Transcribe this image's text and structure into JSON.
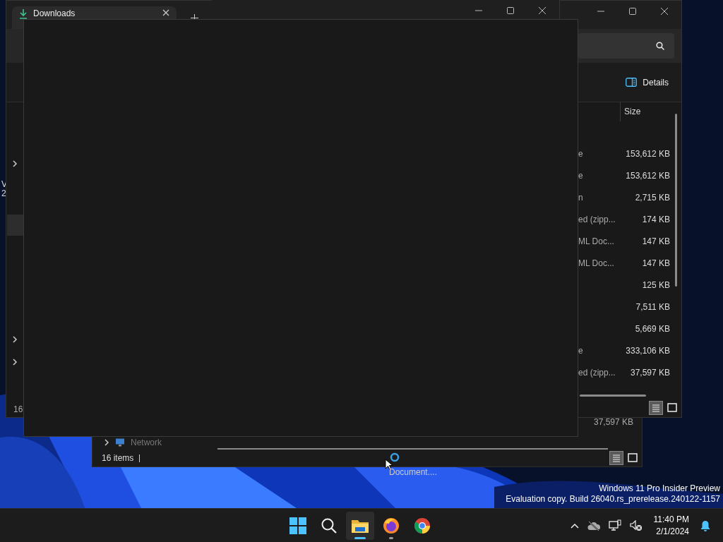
{
  "desktop": {
    "labels": [
      "V",
      "2"
    ],
    "watermark": [
      "Windows 11 Pro Insider Preview",
      "Evaluation copy. Build 26040.rs_prerelease.240122-1157"
    ],
    "cursor_tooltip": "Document...."
  },
  "back_window": {
    "sidebar_item": "Network",
    "size": "37,597 KB",
    "status": "16 items",
    "views": [
      {
        "kind": "details",
        "selected": true
      },
      {
        "kind": "tiles",
        "selected": false
      }
    ]
  },
  "explorer": {
    "tab": {
      "label": "Downloads",
      "selected": true
    },
    "command": "Details",
    "columns": [
      "Size"
    ],
    "rows": [
      {
        "type": "e",
        "size": "153,612 KB"
      },
      {
        "type": "e",
        "size": "153,612 KB"
      },
      {
        "type": "n",
        "size": "2,715 KB"
      },
      {
        "type": "ed (zipp...",
        "size": "174 KB"
      },
      {
        "type": "ML Doc...",
        "size": "147 KB"
      },
      {
        "type": "ML Doc...",
        "size": "147 KB"
      },
      {
        "size": "125 KB"
      },
      {
        "size": "7,511 KB"
      },
      {
        "size": "5,669 KB"
      },
      {
        "type": "e",
        "size": "333,106 KB"
      },
      {
        "type": "ed (zipp...",
        "size": "37,597 KB"
      }
    ],
    "sidebar": [
      {
        "expanded": false,
        "selected": false
      },
      {
        "selected": true
      },
      {
        "expanded": false,
        "selected": false
      },
      {
        "expanded": false,
        "selected": false
      }
    ],
    "status": "16",
    "views": [
      {
        "kind": "details",
        "selected": true
      },
      {
        "kind": "tiles",
        "selected": false
      }
    ]
  },
  "taskbar": {
    "apps": [
      {
        "kind": "start",
        "active": false,
        "running": false
      },
      {
        "kind": "search",
        "active": false,
        "running": false
      },
      {
        "kind": "explorer",
        "active": true,
        "running": true
      },
      {
        "kind": "firefox",
        "active": false,
        "running": true
      },
      {
        "kind": "chrome",
        "active": false,
        "running": false
      }
    ],
    "tray": [
      {
        "kind": "chevron"
      },
      {
        "kind": "cloud"
      },
      {
        "kind": "network"
      },
      {
        "kind": "speaker"
      }
    ],
    "time": "11:40 PM",
    "date": "2/1/2024"
  }
}
